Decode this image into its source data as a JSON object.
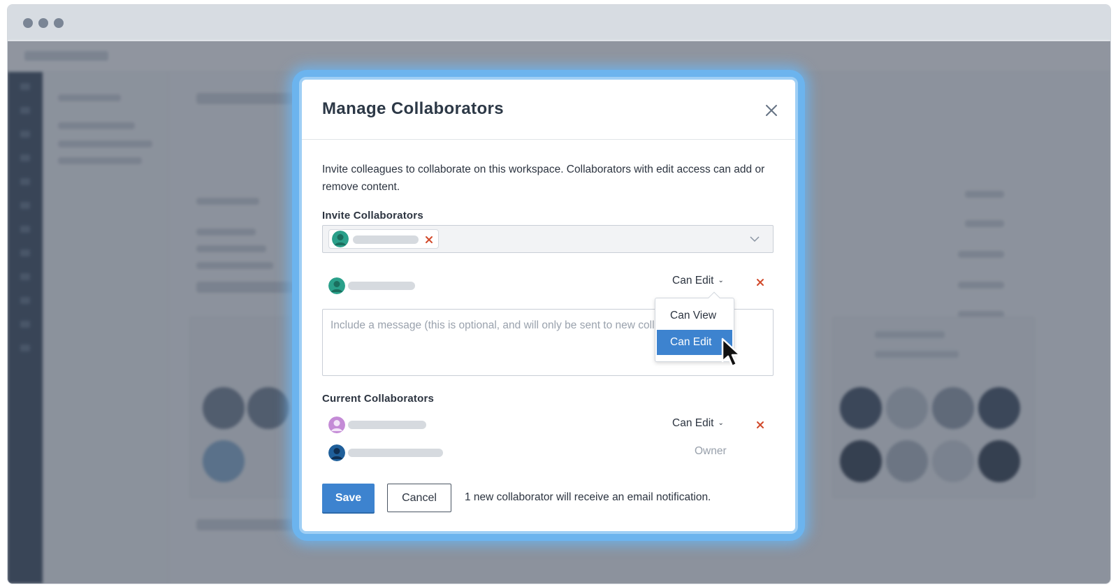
{
  "window": {
    "controls": [
      "dot",
      "dot",
      "dot"
    ]
  },
  "modal": {
    "title": "Manage Collaborators",
    "close_icon": "close-icon",
    "description": "Invite colleagues to collaborate on this workspace. Collaborators with edit access can add or remove content.",
    "invite": {
      "label": "Invite Collaborators",
      "chip_avatar_color": "#2aa08a",
      "remove_icon": "x-icon",
      "dropdown_icon": "chevron-down-icon"
    },
    "new_invitee": {
      "avatar_color": "#2aa08a",
      "permission": "Can Edit"
    },
    "permission_menu": {
      "options": [
        "Can View",
        "Can Edit"
      ],
      "selected": "Can Edit"
    },
    "message": {
      "placeholder": "Include a message (this is optional, and will only be sent to new collaborators)"
    },
    "current": {
      "label": "Current Collaborators",
      "rows": [
        {
          "avatar_color": "#c48bd6",
          "permission": "Can Edit",
          "removable": true
        },
        {
          "avatar_color": "#1f5f9a",
          "role": "Owner",
          "removable": false
        }
      ]
    },
    "footer": {
      "save_label": "Save",
      "cancel_label": "Cancel",
      "notification": "1 new collaborator will receive an email notification."
    }
  },
  "colors": {
    "accent": "#3d83cf",
    "remove": "#d24a2b",
    "glow": "#6cb4ee"
  }
}
